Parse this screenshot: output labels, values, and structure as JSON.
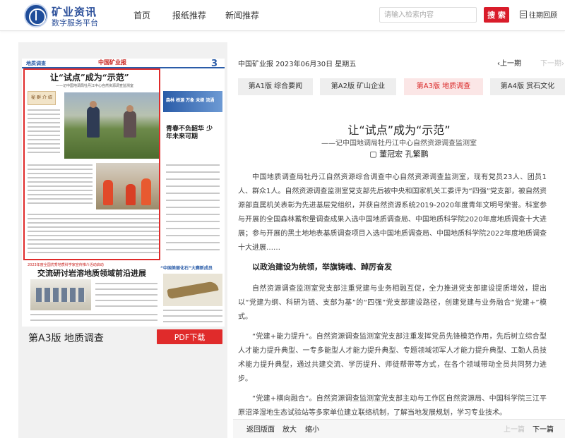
{
  "header": {
    "brand_title": "矿业资讯",
    "brand_subtitle": "数字服务平台",
    "nav": [
      "首页",
      "报纸推荐",
      "新闻推荐"
    ],
    "search_placeholder": "请输入检索内容",
    "search_button": "搜 索",
    "archive_label": "往期回顾"
  },
  "paper_preview": {
    "section_tag": "地质调查",
    "masthead": "中国矿业报",
    "page_number": "3",
    "main_title": "让“试点”成为“示范”",
    "main_subtitle": "——记中国地调局牡丹江中心自然资源调查监测室",
    "tag_box": "秘 群 介 绍",
    "side_banner": "森林 根源 万象 未继 流涌",
    "side_title": "青春不负韶华 少年未来可期",
    "red_bar": "2023年度全国优秀地质科学家宣传推介活动启动",
    "headline2": "交流研讨岩溶地质领域前沿进展",
    "headline2_side": "“中国美丽化石”大赛新成员"
  },
  "page_label": "第A3版 地质调查",
  "pdf_button": "PDF下载",
  "article_meta": {
    "date": "中国矿业报 2023年06月30日 星期五",
    "prev_page": "上一期",
    "next_page": "下一期"
  },
  "tabs": [
    {
      "label": "第A1版 综合要闻",
      "active": false
    },
    {
      "label": "第A2版 矿山企业",
      "active": false
    },
    {
      "label": "第A3版 地质调查",
      "active": true
    },
    {
      "label": "第A4版 赏石文化",
      "active": false
    }
  ],
  "article": {
    "title": "让“试点”成为“示范”",
    "subtitle": "——记中国地调局牡丹江中心自然资源调查监测室",
    "author": "▢ 董冠宏 孔繁鹏",
    "para1": "中国地质调查局牡丹江自然资源综合调查中心自然资源调查监测室，现有党员23人、团员1人、群众1人。自然资源调查监测室党支部先后被中央和国家机关工委评为“四强”党支部，被自然资源部直属机关表彰为先进基层党组织，并获自然资源系统2019-2020年度青年文明号荣誉。科室参与开展的全国森林蓄积量调查成果入选中国地质调查局、中国地质科学院2020年度地质调查十大进展；参与开展的黑土地地表基质调查项目入选中国地质调查局、中国地质科学院2022年度地质调查十大进展……",
    "heading1": "以政治建设为统领，举旗铸魂、踔厉奋发",
    "para2": "自然资源调查监测室党支部注重党建与业务相融互促，全力推进党支部建设提质增效，提出以“党建为纲、科研为链、支部为基”的“四强”党支部建设路径，创建党建与业务融合“党建+”模式。",
    "para3": "“党建+能力提升”。自然资源调查监测室党支部注重发挥党员先锋模范作用，先后树立综合型人才能力提升典型、一专多能型人才能力提升典型、专题领域领军人才能力提升典型、工勤人员技术能力提升典型，通过共建交流、学历提升、师徒帮带等方式，在各个领域带动全员共同努力进步。",
    "para4": "“党建+横向融合”。自然资源调查监测室党支部主动与工作区自然资源局、中国科学院三江平原沼泽湿地生态试验站等多家单位建立联络机制，了解当地发展规划，学习专业技术。"
  },
  "toolbar": {
    "back": "返回版面",
    "zoom_in": "放大",
    "zoom_out": "缩小",
    "prev": "上一篇",
    "next": "下一篇"
  },
  "colors": {
    "accent_red": "#d91c2a",
    "brand_blue": "#2b4f9a",
    "active_tab_bg": "#fbe6e6"
  }
}
